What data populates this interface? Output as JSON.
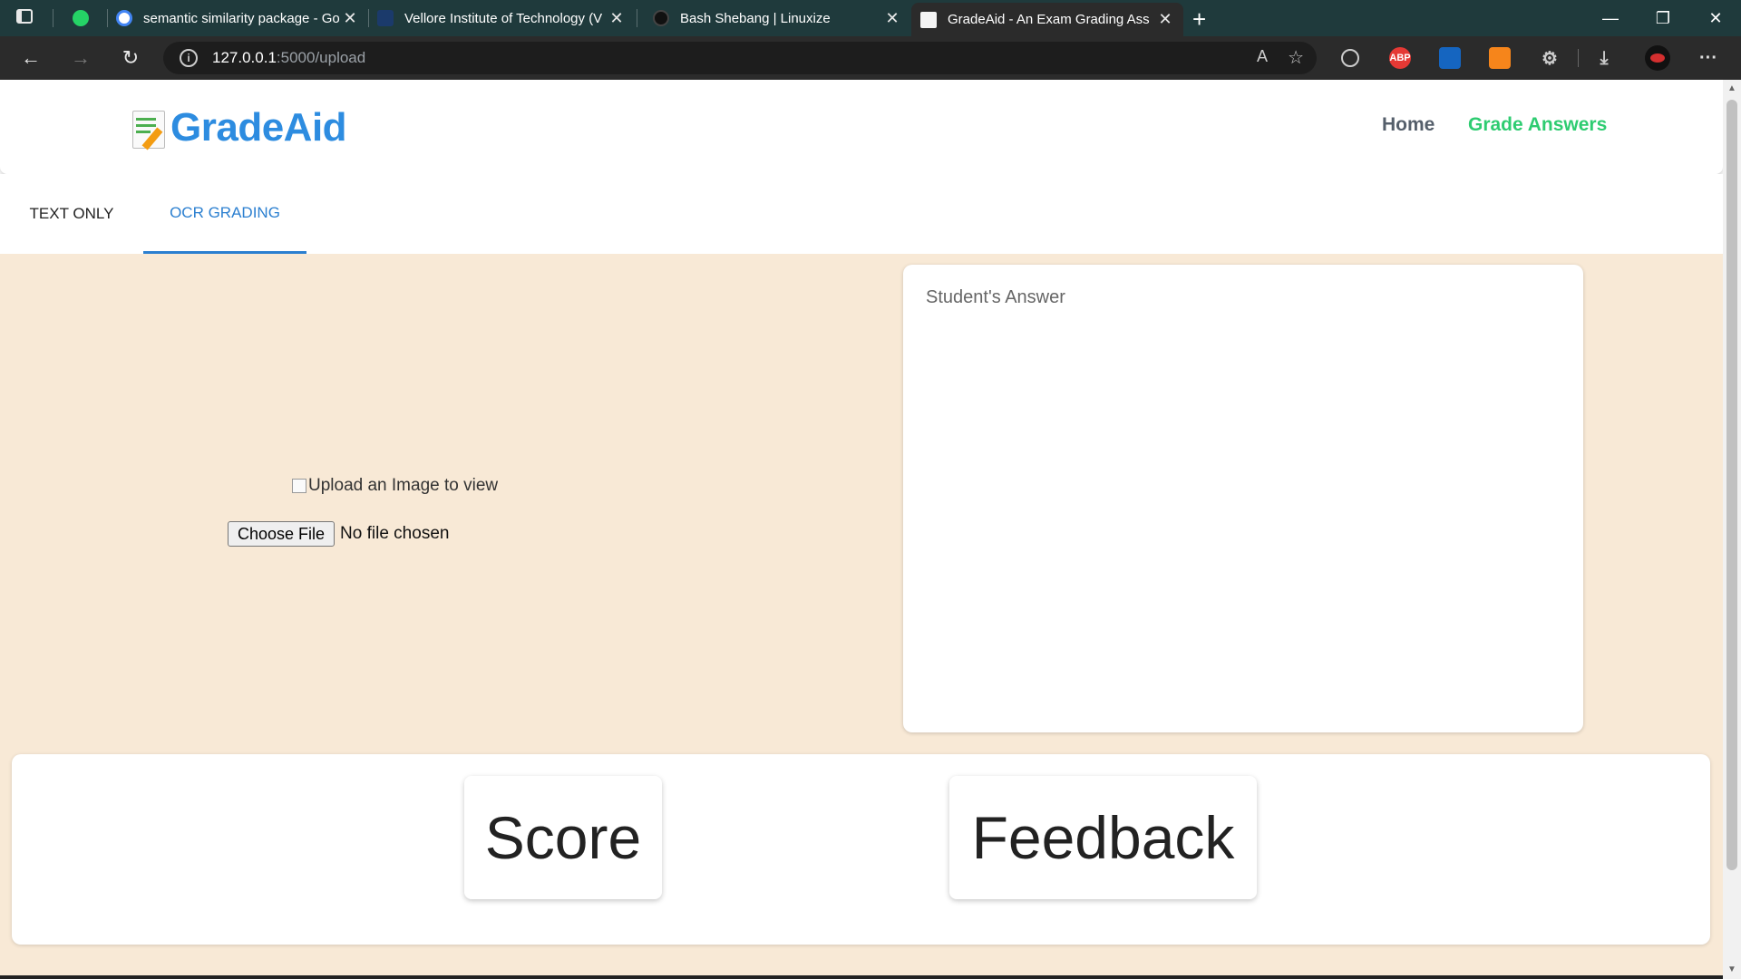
{
  "browser": {
    "tabs": [
      {
        "title": "",
        "favicon": "whatsapp-icon"
      },
      {
        "title": "semantic similarity package - Go",
        "favicon": "google-icon"
      },
      {
        "title": "Vellore Institute of Technology (V",
        "favicon": "vit-icon"
      },
      {
        "title": "Bash Shebang | Linuxize",
        "favicon": "linuxize-icon"
      },
      {
        "title": "GradeAid - An Exam Grading Ass",
        "favicon": "gradeaid-icon",
        "active": true
      }
    ],
    "url_host": "127.0.0.1",
    "url_path": ":5000/upload",
    "extensions": [
      "globe-icon",
      "abp-icon",
      "bitwarden-icon",
      "metamask-icon",
      "puzzle-icon",
      "download-icon",
      "profile-icon",
      "more-icon"
    ],
    "abp_label": "ABP"
  },
  "app": {
    "brand": "GradeAid",
    "nav": {
      "home": "Home",
      "grade": "Grade Answers"
    },
    "tabs": {
      "text_only": "TEXT ONLY",
      "ocr": "OCR GRADING"
    },
    "upload": {
      "image_alt": "Upload an Image to view",
      "choose_file": "Choose File",
      "no_file": "No file chosen"
    },
    "answer_label": "Student's Answer",
    "results": {
      "score": "Score",
      "feedback": "Feedback"
    }
  },
  "colors": {
    "brand": "#2d8ce0",
    "active_nav": "#2ecc71",
    "content_bg": "#f8e9d6",
    "tab_active": "#2b7fd0"
  }
}
